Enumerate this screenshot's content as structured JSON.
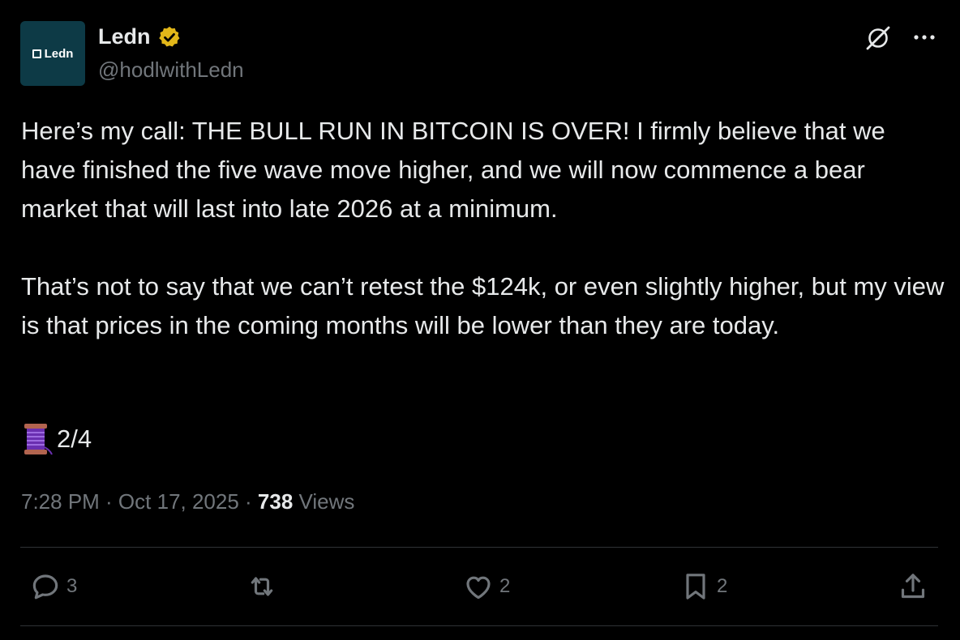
{
  "author": {
    "display_name": "Ledn",
    "handle": "@hodlwithLedn",
    "avatar_text": "Ledn"
  },
  "icons": {
    "verified": "verified-badge-icon",
    "grok": "grok-icon",
    "more": "more-icon",
    "thread": "spool-of-thread-icon",
    "reply": "reply-icon",
    "repost": "repost-icon",
    "like": "like-icon",
    "bookmark": "bookmark-icon",
    "share": "share-icon"
  },
  "tweet": {
    "paragraph_1": "Here’s my call: THE BULL RUN IN BITCOIN IS OVER!  I firmly believe that we have finished the five wave move higher, and we will now commence a bear market that will last into late 2026 at a minimum.",
    "paragraph_2": "That’s not to say that we can’t retest the $124k, or even slightly higher, but my view is that prices in the coming months will be lower than they are today.",
    "thread_counter": "2/4",
    "timestamp": "7:28 PM · Oct 17, 2025 · ",
    "views_count": "738",
    "views_label": " Views"
  },
  "actions": {
    "reply_count": "3",
    "repost_count": "",
    "like_count": "2",
    "bookmark_count": "2"
  },
  "colors": {
    "background": "#000000",
    "text_primary": "#e7e9ea",
    "text_secondary": "#71767b",
    "divider": "#2f3336",
    "verified_gold": "#e2b719",
    "avatar_bg": "#0d3a46"
  }
}
